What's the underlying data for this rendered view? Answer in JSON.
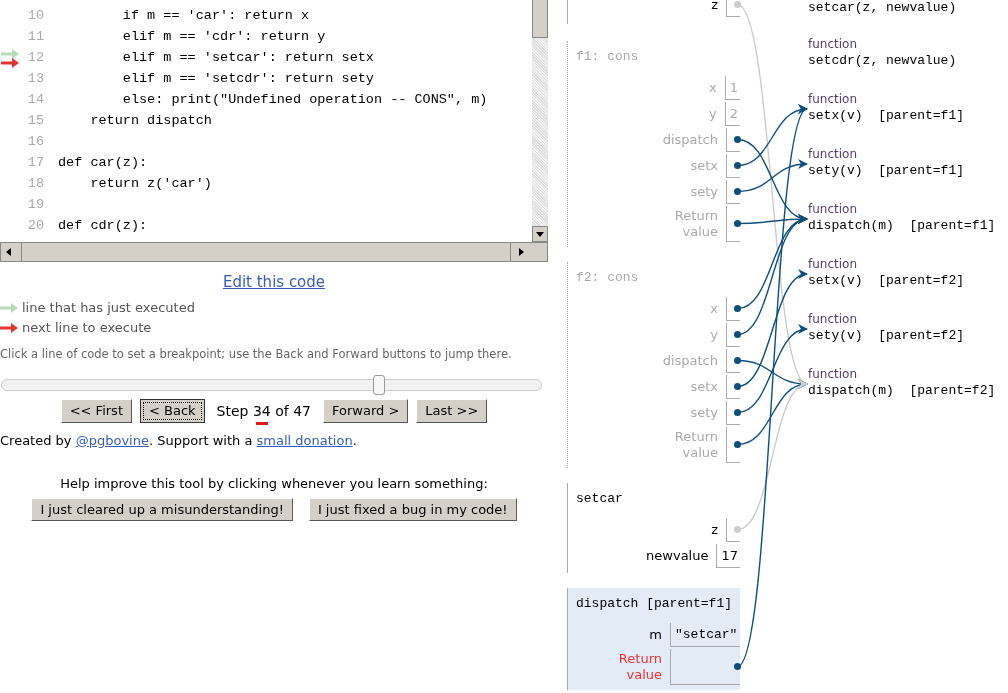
{
  "code": {
    "lines": [
      {
        "number": "10",
        "text": "        if m == 'car': return x",
        "just_executed": false,
        "next_to_execute": false
      },
      {
        "number": "11",
        "text": "        elif m == 'cdr': return y",
        "just_executed": false,
        "next_to_execute": false
      },
      {
        "number": "12",
        "text": "        elif m == 'setcar': return setx",
        "just_executed": true,
        "next_to_execute": true
      },
      {
        "number": "13",
        "text": "        elif m == 'setcdr': return sety",
        "just_executed": false,
        "next_to_execute": false
      },
      {
        "number": "14",
        "text": "        else: print(\"Undefined operation -- CONS\", m)",
        "just_executed": false,
        "next_to_execute": false
      },
      {
        "number": "15",
        "text": "    return dispatch",
        "just_executed": false,
        "next_to_execute": false
      },
      {
        "number": "16",
        "just_executed": false,
        "next_to_execute": false
      },
      {
        "number": "17",
        "text": "def car(z):",
        "just_executed": false,
        "next_to_execute": false
      },
      {
        "number": "18",
        "text": "    return z('car')",
        "just_executed": false,
        "next_to_execute": false
      },
      {
        "number": "19",
        "just_executed": false,
        "next_to_execute": false
      },
      {
        "number": "20",
        "text": "def cdr(z):",
        "just_executed": false,
        "next_to_execute": false
      }
    ]
  },
  "edit_link": "Edit this code",
  "legend": [
    {
      "kind": "just_executed",
      "text": "line that has just executed"
    },
    {
      "kind": "next_to_execute",
      "text": "next line to execute"
    }
  ],
  "hint": "Click a line of code to set a breakpoint; use the Back and Forward buttons to jump there.",
  "slider": {
    "level": 0.7
  },
  "nav": {
    "buttons_before": [
      {
        "label": "<< First",
        "focused": false
      },
      {
        "label": "< Back",
        "focused": true
      }
    ],
    "step": {
      "prefix": "Step",
      "current": "34",
      "suffix": "of 47",
      "underlined": true
    },
    "buttons_after": [
      {
        "label": "Forward >",
        "focused": false
      },
      {
        "label": "Last >>",
        "focused": false
      }
    ]
  },
  "credits": [
    {
      "kind": "text",
      "text": "Created by "
    },
    {
      "kind": "link",
      "text": "@pgbovine"
    },
    {
      "kind": "text",
      "text": ". Support with a "
    },
    {
      "kind": "link",
      "text": "small donation"
    },
    {
      "kind": "text",
      "text": "."
    }
  ],
  "help": {
    "text": "Help improve this tool by clicking whenever you learn something:",
    "buttons": [
      "I just cleared up a misunderstanding!",
      "I just fixed a bug in my code!"
    ]
  },
  "frames": [
    {
      "faded": false,
      "highlighted": false,
      "variables": [
        {
          "name": "z",
          "kind": "var",
          "pointer": {
            "faded": true
          }
        }
      ]
    },
    {
      "title": "f1: cons",
      "faded": true,
      "highlighted": false,
      "variables": [
        {
          "name": "x",
          "kind": "var",
          "value": "1"
        },
        {
          "name": "y",
          "kind": "var",
          "value": "2"
        },
        {
          "name": "dispatch",
          "kind": "var",
          "pointer": {
            "faded": false
          }
        },
        {
          "name": "setx",
          "kind": "var",
          "pointer": {
            "faded": false
          }
        },
        {
          "name": "sety",
          "kind": "var",
          "pointer": {
            "faded": false
          }
        },
        {
          "name": "Return value",
          "kind": "return",
          "pointer": {
            "faded": false
          }
        }
      ]
    },
    {
      "title": "f2: cons",
      "faded": true,
      "highlighted": false,
      "variables": [
        {
          "name": "x",
          "kind": "var",
          "pointer": {
            "faded": false
          }
        },
        {
          "name": "y",
          "kind": "var",
          "pointer": {
            "faded": false
          }
        },
        {
          "name": "dispatch",
          "kind": "var",
          "pointer": {
            "faded": false
          }
        },
        {
          "name": "setx",
          "kind": "var",
          "pointer": {
            "faded": false
          }
        },
        {
          "name": "sety",
          "kind": "var",
          "pointer": {
            "faded": false
          }
        },
        {
          "name": "Return value",
          "kind": "return",
          "pointer": {
            "faded": false
          }
        }
      ]
    },
    {
      "title": "setcar",
      "faded": false,
      "highlighted": false,
      "variables": [
        {
          "name": "z",
          "kind": "var",
          "pointer": {
            "faded": true
          }
        },
        {
          "name": "newvalue",
          "kind": "var",
          "value": "17"
        }
      ]
    },
    {
      "title": "dispatch [parent=f1]",
      "faded": false,
      "highlighted": true,
      "variables": [
        {
          "name": "m",
          "kind": "var",
          "value": "\"setcar\""
        },
        {
          "name": "Return value",
          "kind": "return",
          "pointer": {
            "faded": false
          }
        }
      ]
    }
  ],
  "objects": [
    {
      "signature": "setcar(z, newvalue)"
    },
    {
      "label": "function",
      "signature": "setcdr(z, newvalue)"
    },
    {
      "label": "function",
      "signature": "setx(v)  [parent=f1]"
    },
    {
      "label": "function",
      "signature": "sety(v)  [parent=f1]"
    },
    {
      "label": "function",
      "signature": "dispatch(m)  [parent=f1]"
    },
    {
      "label": "function",
      "signature": "setx(v)  [parent=f2]"
    },
    {
      "label": "function",
      "signature": "sety(v)  [parent=f2]"
    },
    {
      "label": "function",
      "signature": "dispatch(m)  [parent=f2]"
    }
  ]
}
